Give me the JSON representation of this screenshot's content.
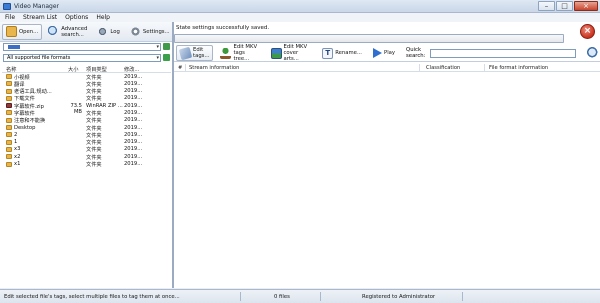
{
  "window": {
    "title": "Video Manager",
    "min": "–",
    "max": "□",
    "close": "×"
  },
  "menu": [
    "File",
    "Stream List",
    "Options",
    "Help"
  ],
  "left_toolbar": {
    "open": "Open...",
    "advanced_search": "Advanced search...",
    "log": "Log",
    "settings": "Settings..."
  },
  "filter": {
    "value": "All supported file formats"
  },
  "file_columns": {
    "name": "名称",
    "size": "大小",
    "type": "项目类型",
    "modified": "修改..."
  },
  "files": [
    {
      "name": "小视频",
      "size": "",
      "type": "文件夹",
      "modified": "2019..."
    },
    {
      "name": "翻译",
      "size": "",
      "type": "文件夹",
      "modified": "2019..."
    },
    {
      "name": "老语工具.规动...",
      "size": "",
      "type": "文件夹",
      "modified": "2019..."
    },
    {
      "name": "下载文件",
      "size": "",
      "type": "文件夹",
      "modified": "2019..."
    },
    {
      "name": "字幕软件.zip",
      "size": "73.5 MB",
      "type": "WinRAR ZIP ...",
      "modified": "2019..."
    },
    {
      "name": "字幕软件",
      "size": "",
      "type": "文件夹",
      "modified": "2019..."
    },
    {
      "name": "注意和不能换",
      "size": "",
      "type": "文件夹",
      "modified": "2019..."
    },
    {
      "name": "Desktop",
      "size": "",
      "type": "文件夹",
      "modified": "2019..."
    },
    {
      "name": "2",
      "size": "",
      "type": "文件夹",
      "modified": "2019..."
    },
    {
      "name": "1",
      "size": "",
      "type": "文件夹",
      "modified": "2019..."
    },
    {
      "name": "x3",
      "size": "",
      "type": "文件夹",
      "modified": "2019..."
    },
    {
      "name": "x2",
      "size": "",
      "type": "文件夹",
      "modified": "2019..."
    },
    {
      "name": "x1",
      "size": "",
      "type": "文件夹",
      "modified": "2019..."
    }
  ],
  "status_message": "State settings successfully saved.",
  "right_toolbar": {
    "edit_tags": "Edit tags...",
    "edit_mkv_tree": "Edit MKV tags tree...",
    "edit_mkv_cover": "Edit MKV cover arts...",
    "rename": "Rename...",
    "play": "Play",
    "quick_search_label": "Quick search:"
  },
  "grid_columns": {
    "index": "#",
    "stream": "Stream information",
    "classification": "Classification",
    "format": "File format information"
  },
  "statusbar": {
    "hint": "Edit selected file's tags, select multiple files to tag them at once...",
    "count": "0 files",
    "registered": "Registered to Administrator"
  }
}
